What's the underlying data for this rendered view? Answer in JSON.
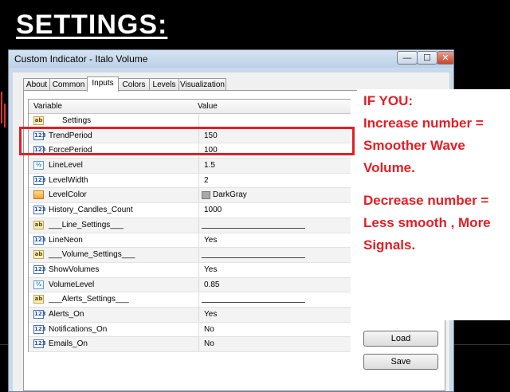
{
  "page": {
    "heading": "SETTINGS:"
  },
  "window": {
    "title": "Custom Indicator - Italo Volume",
    "buttons": {
      "minimize": "—",
      "maximize": "☐",
      "close": "✕"
    }
  },
  "tabs": [
    {
      "label": "About"
    },
    {
      "label": "Common"
    },
    {
      "label": "Inputs",
      "active": true
    },
    {
      "label": "Colors"
    },
    {
      "label": "Levels"
    },
    {
      "label": "Visualization"
    }
  ],
  "grid": {
    "headers": {
      "variable": "Variable",
      "value": "Value"
    },
    "rows": [
      {
        "type": "str",
        "icon": "ab",
        "name": "Settings",
        "value": ""
      },
      {
        "type": "num",
        "icon": "123",
        "name": "TrendPeriod",
        "value": "150"
      },
      {
        "type": "num",
        "icon": "123",
        "name": "ForcePeriod",
        "value": "100"
      },
      {
        "type": "frac",
        "icon": "½",
        "name": "LineLevel",
        "value": "1.5"
      },
      {
        "type": "num",
        "icon": "123",
        "name": "LevelWidth",
        "value": "2"
      },
      {
        "type": "col",
        "icon": "",
        "name": "LevelColor",
        "value": "DarkGray",
        "swatch": "#a9a9a9"
      },
      {
        "type": "num",
        "icon": "123",
        "name": "History_Candles_Count",
        "value": "1000"
      },
      {
        "type": "str",
        "icon": "ab",
        "name": "___Line_Settings___",
        "value": "",
        "line": true
      },
      {
        "type": "num",
        "icon": "123",
        "name": "LineNeon",
        "value": "Yes"
      },
      {
        "type": "str",
        "icon": "ab",
        "name": "___Volume_Settings___",
        "value": "",
        "line": true
      },
      {
        "type": "num",
        "icon": "123",
        "name": "ShowVolumes",
        "value": "Yes"
      },
      {
        "type": "frac",
        "icon": "½",
        "name": "VolumeLevel",
        "value": "0.85"
      },
      {
        "type": "str",
        "icon": "ab",
        "name": "___Alerts_Settings___",
        "value": "",
        "line": true
      },
      {
        "type": "num",
        "icon": "123",
        "name": "Alerts_On",
        "value": "Yes"
      },
      {
        "type": "num",
        "icon": "123",
        "name": "Notifications_On",
        "value": "No"
      },
      {
        "type": "num",
        "icon": "123",
        "name": "Emails_On",
        "value": "No"
      }
    ]
  },
  "actions": {
    "load": "Load",
    "save": "Save"
  },
  "callout": {
    "lines1": [
      "IF YOU:",
      "Increase number =",
      "Smoother Wave",
      "Volume."
    ],
    "lines2": [
      "Decrease number =",
      "Less smooth , More",
      "Signals."
    ]
  },
  "colors": {
    "accent_red": "#e31e24",
    "window_frame": "#c9d9ea"
  }
}
